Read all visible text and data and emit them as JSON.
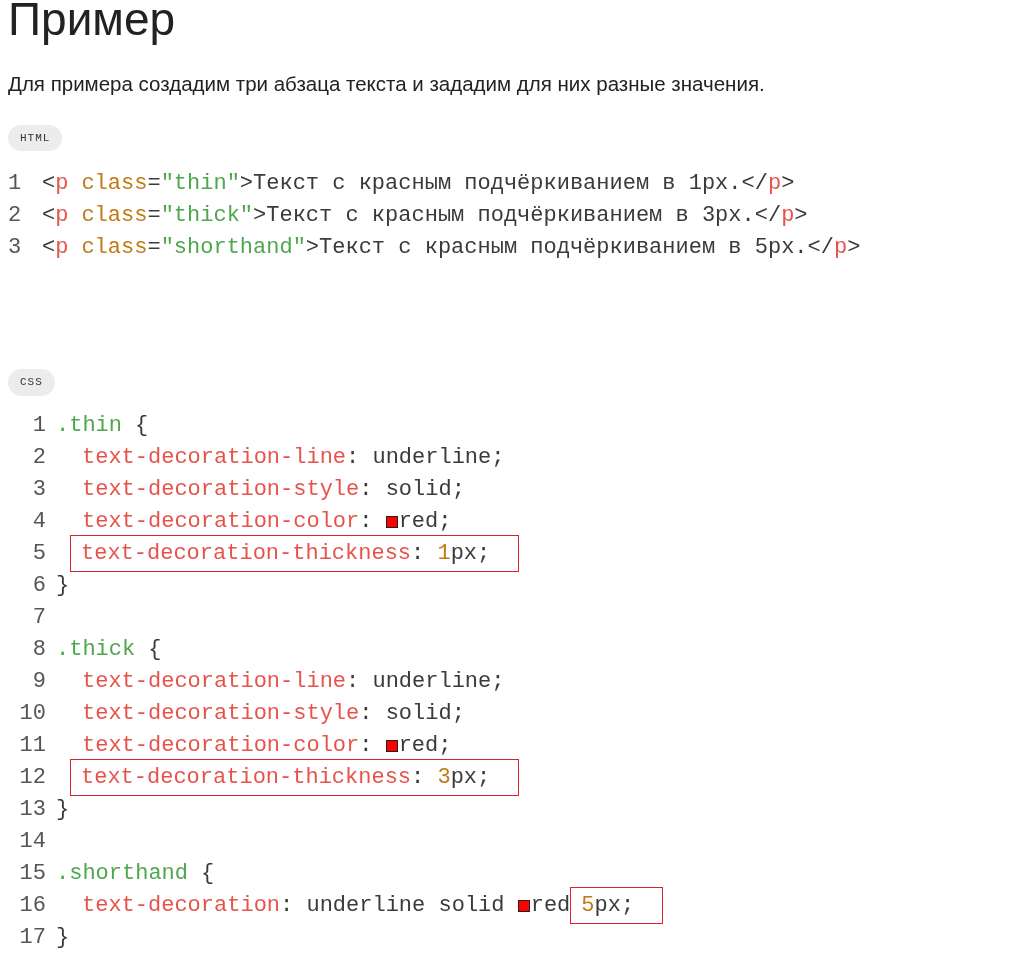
{
  "heading": "Пример",
  "intro": "Для примера создадим три абзаца текста и зададим для них разные значения.",
  "blocks": [
    {
      "language": "HTML",
      "lines": [
        {
          "number": "1",
          "indented": false,
          "segments": [
            {
              "kind": "code",
              "tokens": [
                {
                  "text": "<",
                  "kind": "plain"
                },
                {
                  "text": "p",
                  "kind": "tag"
                },
                {
                  "text": "class",
                  "kind": "attr"
                },
                {
                  "text": "=",
                  "kind": "plain"
                },
                {
                  "text": "\"thin\"",
                  "kind": "string"
                },
                {
                  "text": ">Текст с красным подчёркиванием в 1px.</",
                  "kind": "plain"
                },
                {
                  "text": "p",
                  "kind": "tag"
                },
                {
                  "text": ">",
                  "kind": "plain"
                }
              ]
            }
          ]
        },
        {
          "number": "2",
          "indented": false,
          "segments": [
            {
              "kind": "code",
              "tokens": [
                {
                  "text": "<",
                  "kind": "plain"
                },
                {
                  "text": "p",
                  "kind": "tag"
                },
                {
                  "text": "class",
                  "kind": "attr"
                },
                {
                  "text": "=",
                  "kind": "plain"
                },
                {
                  "text": "\"thick\"",
                  "kind": "string"
                },
                {
                  "text": ">Текст с красным подчёркиванием в 3px.</",
                  "kind": "plain"
                },
                {
                  "text": "p",
                  "kind": "tag"
                },
                {
                  "text": ">",
                  "kind": "plain"
                }
              ]
            }
          ]
        },
        {
          "number": "3",
          "indented": false,
          "segments": [
            {
              "kind": "code",
              "tokens": [
                {
                  "text": "<",
                  "kind": "plain"
                },
                {
                  "text": "p",
                  "kind": "tag"
                },
                {
                  "text": "class",
                  "kind": "attr"
                },
                {
                  "text": "=",
                  "kind": "plain"
                },
                {
                  "text": "\"shorthand\"",
                  "kind": "string"
                },
                {
                  "text": ">Текст с красным подчёркиванием в 5px.</",
                  "kind": "plain"
                },
                {
                  "text": "p",
                  "kind": "tag"
                },
                {
                  "text": ">",
                  "kind": "plain"
                }
              ]
            }
          ]
        }
      ]
    },
    {
      "language": "CSS",
      "lines": [
        {
          "number": "1",
          "indented": false,
          "segments": [
            {
              "kind": "code",
              "tokens": [
                {
                  "text": ".thin",
                  "kind": "selector"
                },
                {
                  "text": "{",
                  "kind": "plain"
                }
              ]
            }
          ]
        },
        {
          "number": "2",
          "indented": true,
          "segments": [
            {
              "kind": "code",
              "tokens": [
                {
                  "text": "text-decoration-line",
                  "kind": "property"
                },
                {
                  "text": ": underline;",
                  "kind": "plain"
                }
              ]
            }
          ]
        },
        {
          "number": "3",
          "indented": true,
          "segments": [
            {
              "kind": "code",
              "tokens": [
                {
                  "text": "text-decoration-style",
                  "kind": "property"
                },
                {
                  "text": ": solid;",
                  "kind": "plain"
                }
              ]
            }
          ]
        },
        {
          "number": "4",
          "indented": true,
          "segments": [
            {
              "kind": "code",
              "tokens": [
                {
                  "text": "text-decoration-color",
                  "kind": "property"
                },
                {
                  "text": ": ",
                  "kind": "plain"
                }
              ]
            },
            {
              "kind": "swatch",
              "color": "#ff0000"
            },
            {
              "kind": "code",
              "tokens": [
                {
                  "text": "red;",
                  "kind": "plain"
                }
              ]
            }
          ]
        },
        {
          "number": "5",
          "indented": true,
          "segments": [
            {
              "kind": "highlight",
              "tokens": [
                {
                  "text": "text-decoration-thickness",
                  "kind": "property"
                },
                {
                  "text": ": ",
                  "kind": "plain"
                },
                {
                  "text": "1",
                  "kind": "number"
                },
                {
                  "text": "px;",
                  "kind": "plain"
                }
              ]
            }
          ]
        },
        {
          "number": "6",
          "indented": false,
          "segments": [
            {
              "kind": "code",
              "tokens": [
                {
                  "text": "}",
                  "kind": "plain"
                }
              ]
            }
          ]
        },
        {
          "number": "7"
        },
        {
          "number": "8",
          "indented": false,
          "segments": [
            {
              "kind": "code",
              "tokens": [
                {
                  "text": ".thick",
                  "kind": "selector"
                },
                {
                  "text": "{",
                  "kind": "plain"
                }
              ]
            }
          ]
        },
        {
          "number": "9",
          "indented": true,
          "segments": [
            {
              "kind": "code",
              "tokens": [
                {
                  "text": "text-decoration-line",
                  "kind": "property"
                },
                {
                  "text": ": underline;",
                  "kind": "plain"
                }
              ]
            }
          ]
        },
        {
          "number": "10",
          "indented": true,
          "segments": [
            {
              "kind": "code",
              "tokens": [
                {
                  "text": "text-decoration-style",
                  "kind": "property"
                },
                {
                  "text": ": solid;",
                  "kind": "plain"
                }
              ]
            }
          ]
        },
        {
          "number": "11",
          "indented": true,
          "segments": [
            {
              "kind": "code",
              "tokens": [
                {
                  "text": "text-decoration-color",
                  "kind": "property"
                },
                {
                  "text": ": ",
                  "kind": "plain"
                }
              ]
            },
            {
              "kind": "swatch",
              "color": "#ff0000"
            },
            {
              "kind": "code",
              "tokens": [
                {
                  "text": "red;",
                  "kind": "plain"
                }
              ]
            }
          ]
        },
        {
          "number": "12",
          "indented": true,
          "segments": [
            {
              "kind": "highlight",
              "tokens": [
                {
                  "text": "text-decoration-thickness",
                  "kind": "property"
                },
                {
                  "text": ": ",
                  "kind": "plain"
                },
                {
                  "text": "3",
                  "kind": "number"
                },
                {
                  "text": "px;",
                  "kind": "plain"
                }
              ]
            }
          ]
        },
        {
          "number": "13",
          "indented": false,
          "segments": [
            {
              "kind": "code",
              "tokens": [
                {
                  "text": "}",
                  "kind": "plain"
                }
              ]
            }
          ]
        },
        {
          "number": "14"
        },
        {
          "number": "15",
          "indented": false,
          "segments": [
            {
              "kind": "code",
              "tokens": [
                {
                  "text": ".shorthand",
                  "kind": "selector"
                },
                {
                  "text": "{",
                  "kind": "plain"
                }
              ]
            }
          ]
        },
        {
          "number": "16",
          "indented": true,
          "segments": [
            {
              "kind": "code",
              "tokens": [
                {
                  "text": "text-decoration",
                  "kind": "property"
                },
                {
                  "text": ": underline solid ",
                  "kind": "plain"
                }
              ]
            },
            {
              "kind": "swatch",
              "color": "#ff0000"
            },
            {
              "kind": "code",
              "tokens": [
                {
                  "text": "red",
                  "kind": "plain"
                }
              ]
            },
            {
              "kind": "highlight",
              "tokens": [
                {
                  "text": "5",
                  "kind": "number"
                },
                {
                  "text": "px;",
                  "kind": "plain"
                }
              ]
            }
          ]
        },
        {
          "number": "17",
          "indented": false,
          "segments": [
            {
              "kind": "code",
              "tokens": [
                {
                  "text": "}",
                  "kind": "plain"
                }
              ]
            }
          ]
        }
      ]
    }
  ]
}
